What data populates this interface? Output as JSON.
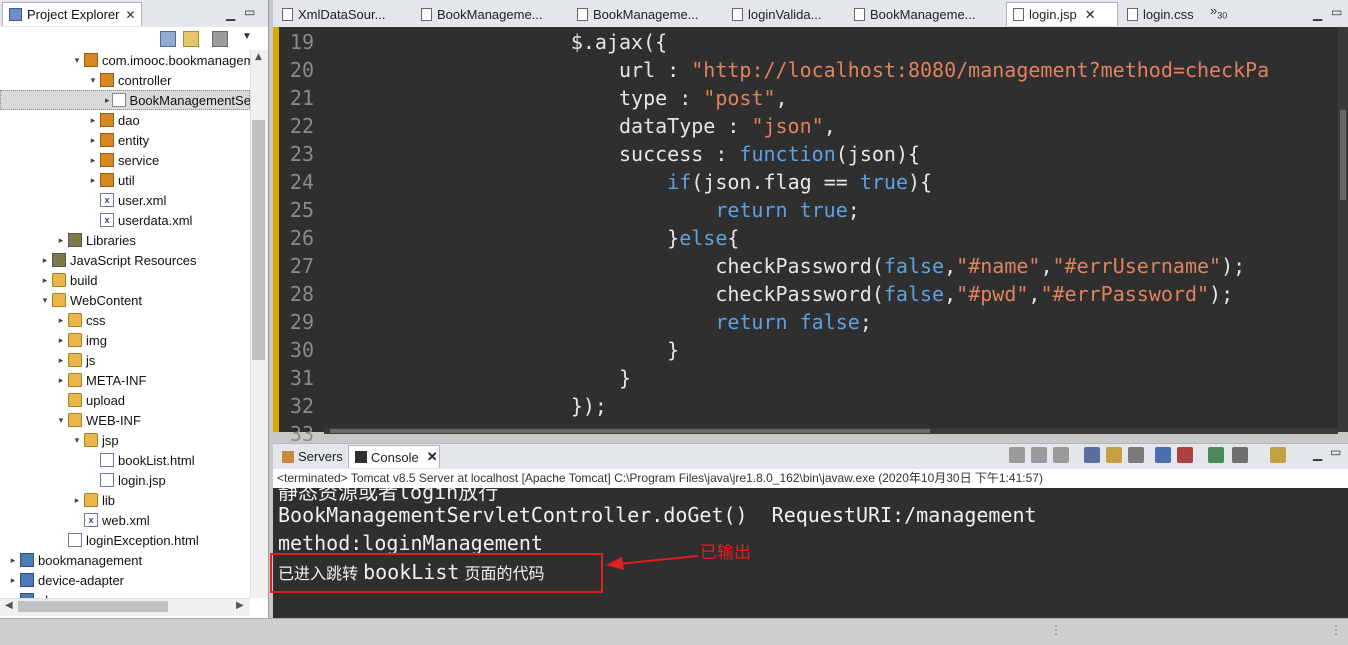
{
  "project_explorer": {
    "tab_label": "Project Explorer",
    "tree": [
      {
        "label": "com.imooc.bookmanagem",
        "indent": 4,
        "twisty": "▾",
        "icon": "package"
      },
      {
        "label": "controller",
        "indent": 5,
        "twisty": "▾",
        "icon": "package"
      },
      {
        "label": "BookManagementSer",
        "indent": 6,
        "twisty": "▸",
        "icon": "java-file",
        "selected": true
      },
      {
        "label": "dao",
        "indent": 5,
        "twisty": "▸",
        "icon": "package"
      },
      {
        "label": "entity",
        "indent": 5,
        "twisty": "▸",
        "icon": "package"
      },
      {
        "label": "service",
        "indent": 5,
        "twisty": "▸",
        "icon": "package"
      },
      {
        "label": "util",
        "indent": 5,
        "twisty": "▸",
        "icon": "package"
      },
      {
        "label": "user.xml",
        "indent": 5,
        "twisty": "",
        "icon": "xml-file"
      },
      {
        "label": "userdata.xml",
        "indent": 5,
        "twisty": "",
        "icon": "xml-file"
      },
      {
        "label": "Libraries",
        "indent": 3,
        "twisty": "▸",
        "icon": "library"
      },
      {
        "label": "JavaScript Resources",
        "indent": 2,
        "twisty": "▸",
        "icon": "library"
      },
      {
        "label": "build",
        "indent": 2,
        "twisty": "▸",
        "icon": "folder"
      },
      {
        "label": "WebContent",
        "indent": 2,
        "twisty": "▾",
        "icon": "folder"
      },
      {
        "label": "css",
        "indent": 3,
        "twisty": "▸",
        "icon": "folder"
      },
      {
        "label": "img",
        "indent": 3,
        "twisty": "▸",
        "icon": "folder"
      },
      {
        "label": "js",
        "indent": 3,
        "twisty": "▸",
        "icon": "folder"
      },
      {
        "label": "META-INF",
        "indent": 3,
        "twisty": "▸",
        "icon": "folder"
      },
      {
        "label": "upload",
        "indent": 3,
        "twisty": "",
        "icon": "folder"
      },
      {
        "label": "WEB-INF",
        "indent": 3,
        "twisty": "▾",
        "icon": "folder"
      },
      {
        "label": "jsp",
        "indent": 4,
        "twisty": "▾",
        "icon": "folder"
      },
      {
        "label": "bookList.html",
        "indent": 5,
        "twisty": "",
        "icon": "html-file"
      },
      {
        "label": "login.jsp",
        "indent": 5,
        "twisty": "",
        "icon": "html-file"
      },
      {
        "label": "lib",
        "indent": 4,
        "twisty": "▸",
        "icon": "folder"
      },
      {
        "label": "web.xml",
        "indent": 4,
        "twisty": "",
        "icon": "xml-file"
      },
      {
        "label": "loginException.html",
        "indent": 3,
        "twisty": "",
        "icon": "html-file"
      },
      {
        "label": "bookmanagement",
        "indent": 0,
        "twisty": "▸",
        "icon": "project"
      },
      {
        "label": "device-adapter",
        "indent": 0,
        "twisty": "▸",
        "icon": "project"
      },
      {
        "label": "el",
        "indent": 0,
        "twisty": "▸",
        "icon": "project"
      }
    ]
  },
  "editor": {
    "tabs": [
      {
        "label": "XmlDataSour...",
        "active": false
      },
      {
        "label": "BookManageme...",
        "active": false
      },
      {
        "label": "BookManageme...",
        "active": false
      },
      {
        "label": "loginValida...",
        "active": false
      },
      {
        "label": "BookManageme...",
        "active": false
      },
      {
        "label": "login.jsp",
        "active": true
      },
      {
        "label": "login.css",
        "active": false
      }
    ],
    "overflow_label": "»",
    "overflow_count": "30",
    "lines": [
      {
        "n": "19",
        "segs": [
          {
            "t": "                    $.ajax({",
            "c": "p"
          }
        ]
      },
      {
        "n": "20",
        "segs": [
          {
            "t": "                        url : ",
            "c": "p"
          },
          {
            "t": "\"http://localhost:8080/management?method=checkPa",
            "c": "s"
          }
        ]
      },
      {
        "n": "21",
        "segs": [
          {
            "t": "                        type : ",
            "c": "p"
          },
          {
            "t": "\"post\"",
            "c": "s"
          },
          {
            "t": ",",
            "c": "p"
          }
        ]
      },
      {
        "n": "22",
        "segs": [
          {
            "t": "                        dataType : ",
            "c": "p"
          },
          {
            "t": "\"json\"",
            "c": "s"
          },
          {
            "t": ",",
            "c": "p"
          }
        ]
      },
      {
        "n": "23",
        "segs": [
          {
            "t": "                        success : ",
            "c": "p"
          },
          {
            "t": "function",
            "c": "k"
          },
          {
            "t": "(json){",
            "c": "p"
          }
        ]
      },
      {
        "n": "24",
        "segs": [
          {
            "t": "                            ",
            "c": "p"
          },
          {
            "t": "if",
            "c": "k"
          },
          {
            "t": "(json.flag == ",
            "c": "p"
          },
          {
            "t": "true",
            "c": "k"
          },
          {
            "t": "){",
            "c": "p"
          }
        ]
      },
      {
        "n": "25",
        "segs": [
          {
            "t": "                                ",
            "c": "p"
          },
          {
            "t": "return true",
            "c": "k"
          },
          {
            "t": ";",
            "c": "p"
          }
        ]
      },
      {
        "n": "26",
        "segs": [
          {
            "t": "                            }",
            "c": "p"
          },
          {
            "t": "else",
            "c": "k"
          },
          {
            "t": "{",
            "c": "p"
          }
        ]
      },
      {
        "n": "27",
        "segs": [
          {
            "t": "                                checkPassword(",
            "c": "p"
          },
          {
            "t": "false",
            "c": "k"
          },
          {
            "t": ",",
            "c": "p"
          },
          {
            "t": "\"#name\"",
            "c": "s"
          },
          {
            "t": ",",
            "c": "p"
          },
          {
            "t": "\"#errUsername\"",
            "c": "s"
          },
          {
            "t": ");",
            "c": "p"
          }
        ]
      },
      {
        "n": "28",
        "segs": [
          {
            "t": "                                checkPassword(",
            "c": "p"
          },
          {
            "t": "false",
            "c": "k"
          },
          {
            "t": ",",
            "c": "p"
          },
          {
            "t": "\"#pwd\"",
            "c": "s"
          },
          {
            "t": ",",
            "c": "p"
          },
          {
            "t": "\"#errPassword\"",
            "c": "s"
          },
          {
            "t": ");",
            "c": "p"
          }
        ]
      },
      {
        "n": "29",
        "segs": [
          {
            "t": "                                ",
            "c": "p"
          },
          {
            "t": "return false",
            "c": "k"
          },
          {
            "t": ";",
            "c": "p"
          }
        ]
      },
      {
        "n": "30",
        "segs": [
          {
            "t": "                            }",
            "c": "p"
          }
        ]
      },
      {
        "n": "31",
        "segs": [
          {
            "t": "                        }",
            "c": "p"
          }
        ]
      },
      {
        "n": "32",
        "segs": [
          {
            "t": "                    });",
            "c": "p"
          }
        ]
      },
      {
        "n": "33",
        "segs": [
          {
            "t": "",
            "c": "p"
          }
        ]
      }
    ],
    "colors": {
      "background": "#2f2f2f",
      "keyword": "#5aa2e6",
      "string": "#e2815e",
      "plain": "#e6e6e6"
    }
  },
  "console": {
    "tabs": [
      {
        "label": "Servers",
        "active": false
      },
      {
        "label": "Console",
        "active": true
      }
    ],
    "status": "<terminated> Tomcat v8.5 Server at localhost [Apache Tomcat] C:\\Program Files\\java\\jre1.8.0_162\\bin\\javaw.exe (2020年10月30日 下午1:41:57)",
    "lines": [
      "静态资源或者login放行",
      "BookManagementServletController.doGet()  RequestURI:/management",
      "method:loginManagement"
    ],
    "highlight_line": {
      "prefix": "已进入跳转 ",
      "code": "bookList",
      "suffix": " 页面的代码"
    },
    "annotation": "已输出",
    "annotation_color": "#e02020"
  }
}
